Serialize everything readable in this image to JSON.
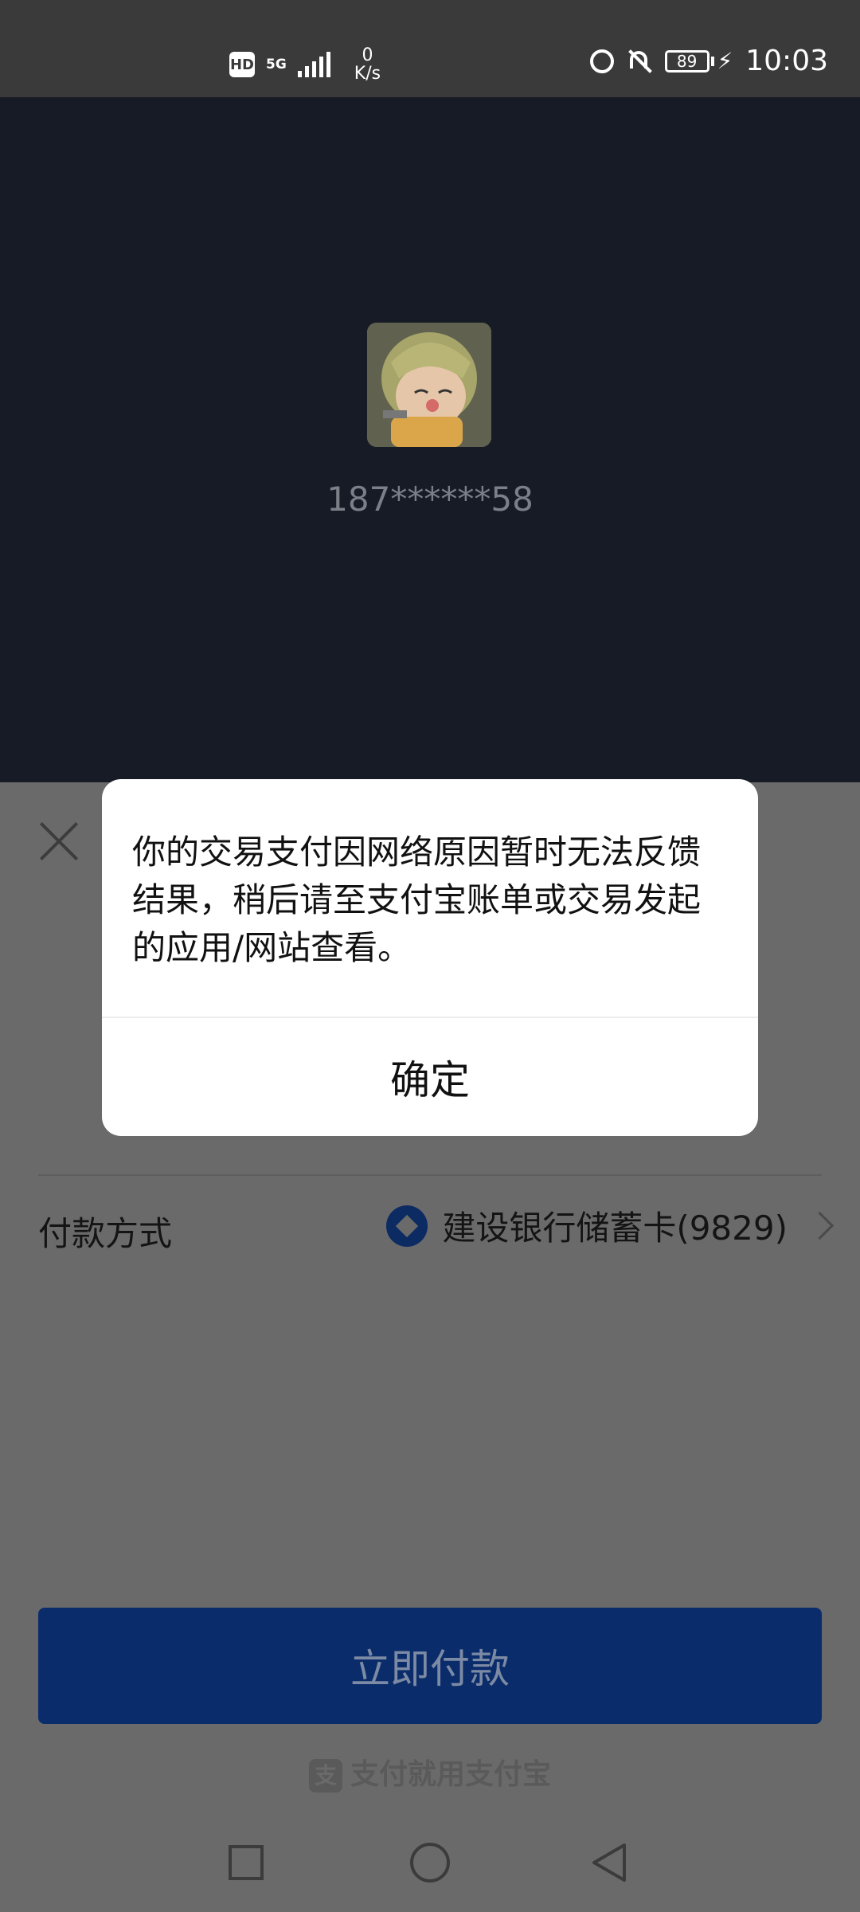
{
  "status_bar": {
    "hd_label": "HD",
    "network": "5G",
    "net_speed_value": "0",
    "net_speed_unit": "K/s",
    "battery": "89",
    "time": "10:03"
  },
  "account": {
    "phone": "187******58"
  },
  "payment": {
    "method_label": "付款方式",
    "method_value": "建设银行储蓄卡(9829)",
    "pay_button": "立即付款",
    "brand_slogan": "支付就用支付宝"
  },
  "dialog": {
    "message": "你的交易支付因网络原因暂时无法反馈结果，稍后请至支付宝账单或交易发起的应用/网站查看。",
    "confirm_label": "确定"
  },
  "colors": {
    "header_bg": "#171b26",
    "dim_bg": "#6a6a6a",
    "button_bg": "#0a2c6b"
  }
}
